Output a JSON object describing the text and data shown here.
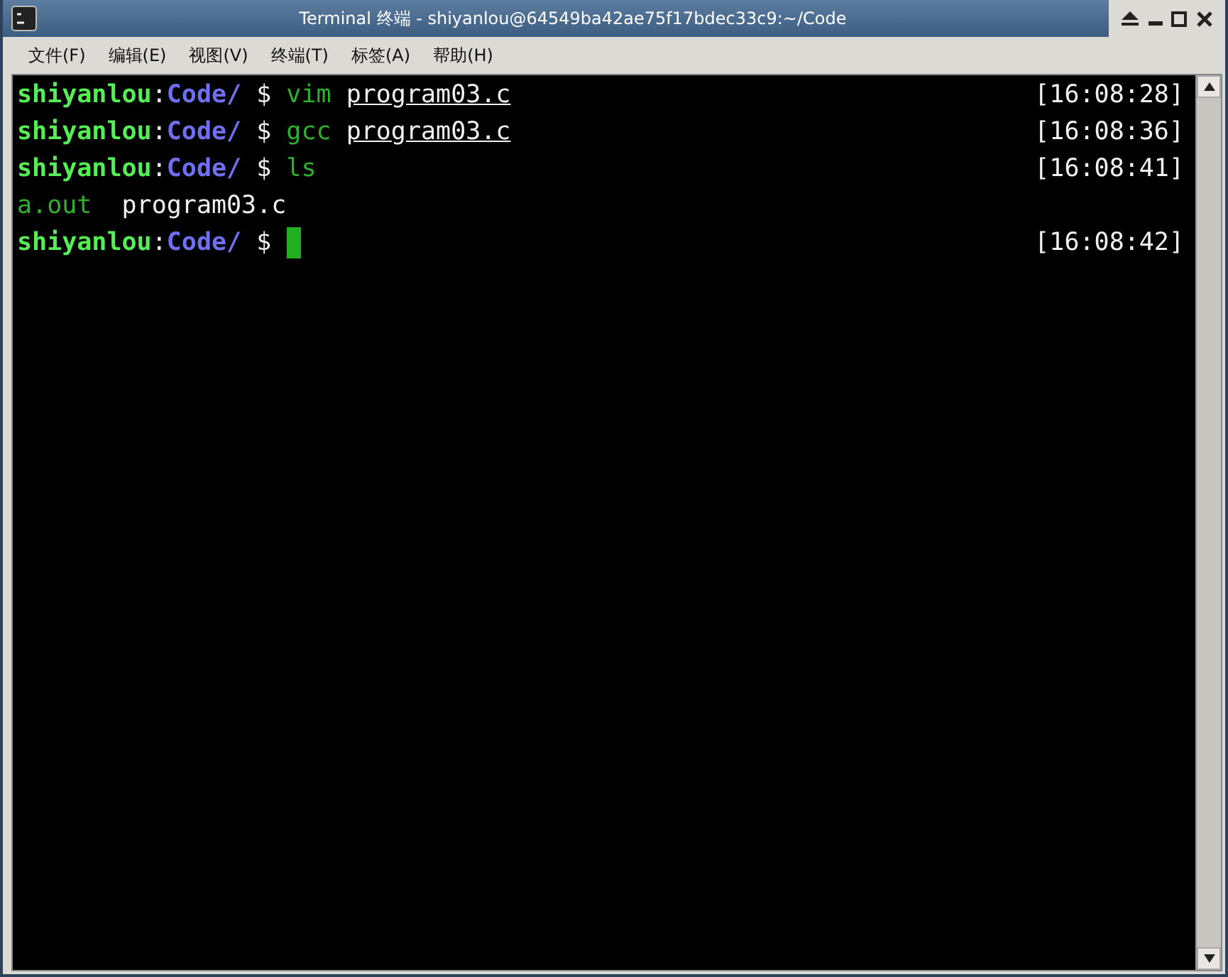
{
  "window": {
    "title": "Terminal 终端 - shiyanlou@64549ba42ae75f17bdec33c9:~/Code"
  },
  "menu": [
    "文件(F)",
    "编辑(E)",
    "视图(V)",
    "终端(T)",
    "标签(A)",
    "帮助(H)"
  ],
  "terminal": {
    "lines": [
      {
        "segments": [
          {
            "text": "shiyanlou",
            "kind": "user"
          },
          {
            "text": ":",
            "kind": "plain"
          },
          {
            "text": "Code/",
            "kind": "path"
          },
          {
            "text": " $ ",
            "kind": "plain"
          },
          {
            "text": "vim ",
            "kind": "command"
          },
          {
            "text": "program03.c",
            "kind": "file"
          }
        ],
        "time": "[16:08:28]",
        "cursor": false
      },
      {
        "segments": [
          {
            "text": "shiyanlou",
            "kind": "user"
          },
          {
            "text": ":",
            "kind": "plain"
          },
          {
            "text": "Code/",
            "kind": "path"
          },
          {
            "text": " $ ",
            "kind": "plain"
          },
          {
            "text": "gcc ",
            "kind": "command"
          },
          {
            "text": "program03.c",
            "kind": "file"
          }
        ],
        "time": "[16:08:36]",
        "cursor": false
      },
      {
        "segments": [
          {
            "text": "shiyanlou",
            "kind": "user"
          },
          {
            "text": ":",
            "kind": "plain"
          },
          {
            "text": "Code/",
            "kind": "path"
          },
          {
            "text": " $ ",
            "kind": "plain"
          },
          {
            "text": "ls",
            "kind": "command"
          }
        ],
        "time": "[16:08:41]",
        "cursor": false
      },
      {
        "segments": [
          {
            "text": "a.out",
            "kind": "exec"
          },
          {
            "text": "  program03.c",
            "kind": "plain"
          }
        ],
        "cursor": false
      },
      {
        "segments": [
          {
            "text": "shiyanlou",
            "kind": "user"
          },
          {
            "text": ":",
            "kind": "plain"
          },
          {
            "text": "Code/",
            "kind": "path"
          },
          {
            "text": " $ ",
            "kind": "plain"
          }
        ],
        "time": "[16:08:42]",
        "cursor": true
      }
    ]
  }
}
